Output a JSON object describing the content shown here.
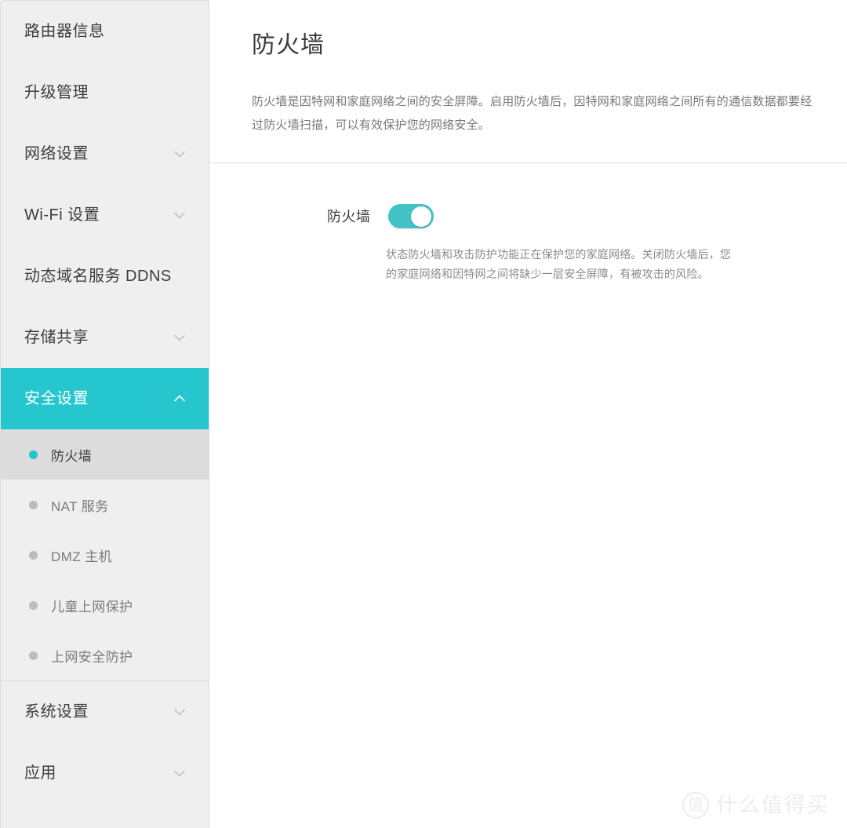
{
  "sidebar": {
    "items": [
      {
        "label": "路由器信息",
        "icon": null,
        "expandable": false,
        "active": false
      },
      {
        "label": "升级管理",
        "icon": null,
        "expandable": false,
        "active": false
      },
      {
        "label": "网络设置",
        "icon": "chevron-down-icon",
        "expandable": true,
        "active": false
      },
      {
        "label": "Wi-Fi 设置",
        "icon": "chevron-down-icon",
        "expandable": true,
        "active": false
      },
      {
        "label": "动态域名服务 DDNS",
        "icon": null,
        "expandable": false,
        "active": false
      },
      {
        "label": "存储共享",
        "icon": "chevron-down-icon",
        "expandable": true,
        "active": false
      },
      {
        "label": "安全设置",
        "icon": "chevron-up-icon",
        "expandable": true,
        "active": true
      },
      {
        "label": "系统设置",
        "icon": "chevron-down-icon",
        "expandable": true,
        "active": false
      },
      {
        "label": "应用",
        "icon": "chevron-down-icon",
        "expandable": true,
        "active": false
      }
    ],
    "submenu": [
      {
        "label": "防火墙",
        "active": true
      },
      {
        "label": "NAT 服务",
        "active": false
      },
      {
        "label": "DMZ 主机",
        "active": false
      },
      {
        "label": "儿童上网保护",
        "active": false
      },
      {
        "label": "上网安全防护",
        "active": false
      }
    ]
  },
  "main": {
    "title": "防火墙",
    "description": "防火墙是因特网和家庭网络之间的安全屏障。启用防火墙后，因特网和家庭网络之间所有的通信数据都要经过防火墙扫描，可以有效保护您的网络安全。",
    "setting": {
      "label": "防火墙",
      "toggle_state": "on",
      "hint_line_1": "状态防火墙和攻击防护功能正在保护您的家庭网络。关闭防火墙后，您",
      "hint_line_2": "的家庭网络和因特网之间将缺少一层安全屏障，有被攻击的风险。"
    }
  },
  "watermark": {
    "logo_char": "值",
    "text": "什么值得买"
  },
  "colors": {
    "accent": "#26c6ce",
    "toggle_on": "#44c3c6",
    "sidebar_bg": "#efefef",
    "submenu_active_bg": "#dcdcdc",
    "bullet_inactive": "#bcbcbc",
    "watermark": "#eceded"
  }
}
